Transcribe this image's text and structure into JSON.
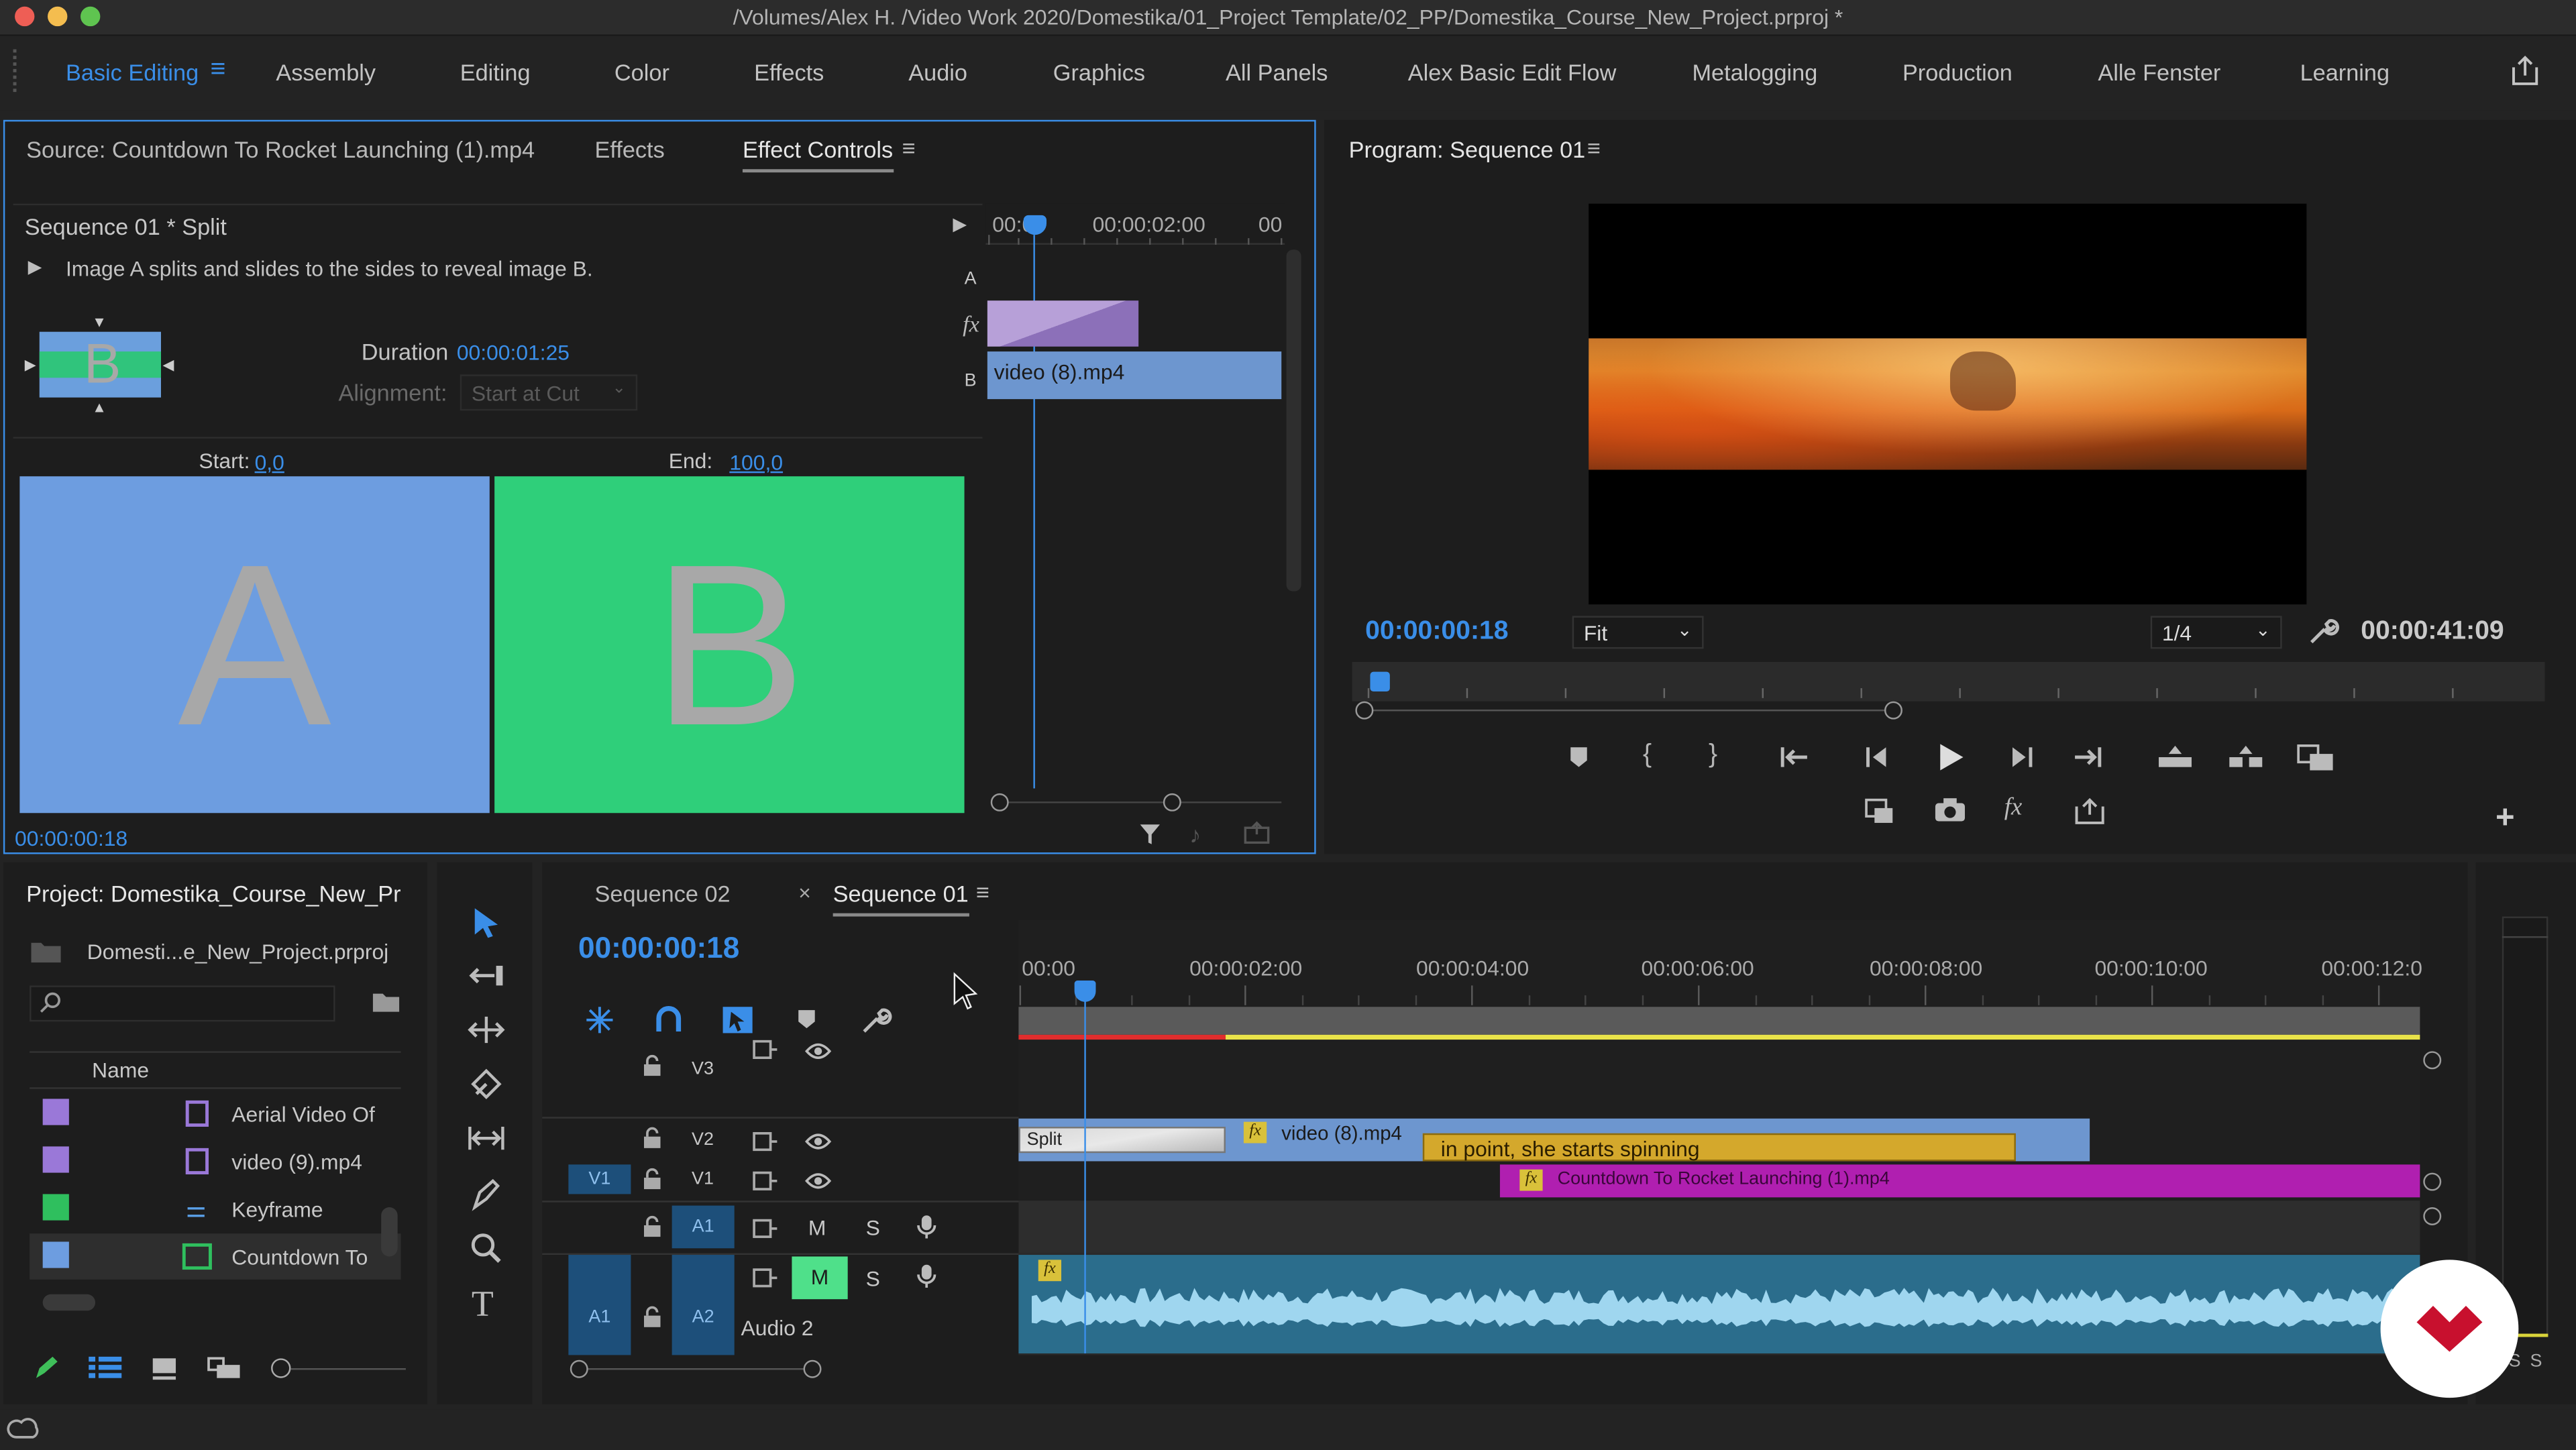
{
  "window": {
    "title": "/Volumes/Alex H. /Video Work 2020/Domestika/01_Project Template/02_PP/Domestika_Course_New_Project.prproj *"
  },
  "workspaces": [
    "Basic Editing",
    "Assembly",
    "Editing",
    "Color",
    "Effects",
    "Audio",
    "Graphics",
    "All Panels",
    "Alex Basic Edit Flow",
    "Metalogging",
    "Production",
    "Alle Fenster",
    "Learning"
  ],
  "source_panel": {
    "tabs": [
      "Source: Countdown To Rocket Launching (1).mp4",
      "Effects",
      "Effect Controls"
    ],
    "sequence_label": "Sequence 01 * Split",
    "description": "Image A splits and slides to the sides to reveal image B.",
    "duration_label": "Duration",
    "duration_value": "00:00:01:25",
    "alignment_label": "Alignment:",
    "alignment_value": "Start at Cut",
    "start_label": "Start:",
    "start_value": "0,0",
    "end_label": "End:",
    "end_value": "100,0",
    "preview_a": "A",
    "preview_b": "B",
    "mini_ruler": [
      "00:00",
      "00:00:02:00",
      "00"
    ],
    "track_a": "A",
    "track_b": "B",
    "fx": "fx",
    "clip_name": "video (8).mp4",
    "timecode": "00:00:00:18"
  },
  "program_panel": {
    "title": "Program: Sequence 01",
    "timecode": "00:00:00:18",
    "fit": "Fit",
    "resolution": "1/4",
    "duration": "00:00:41:09"
  },
  "project_panel": {
    "title": "Project: Domestika_Course_New_Pr",
    "file": "Domesti...e_New_Project.prproj",
    "search_placeholder": "",
    "column": "Name",
    "items": [
      {
        "name": "Aerial Video Of",
        "color": "#9a78d8"
      },
      {
        "name": "video (9).mp4",
        "color": "#9a78d8"
      },
      {
        "name": "Keyframe",
        "color": "#2fbf5e"
      },
      {
        "name": "Countdown To",
        "color": "#6d9de0"
      }
    ]
  },
  "timeline": {
    "tabs": [
      "Sequence 02",
      "Sequence 01"
    ],
    "timecode": "00:00:00:18",
    "ruler": [
      "00:00",
      "00:00:02:00",
      "00:00:04:00",
      "00:00:06:00",
      "00:00:08:00",
      "00:00:10:00",
      "00:00:12:0"
    ],
    "tracks": {
      "v3": "V3",
      "v2": "V2",
      "v1": "V1",
      "a1": "A1",
      "a2": "A2",
      "audio2": "Audio 2",
      "m": "M",
      "s": "S"
    },
    "clips": {
      "split": "Split",
      "video8": "video (8).mp4",
      "marker": "in point, she starts spinning",
      "countdown": "Countdown To Rocket Launching (1).mp4",
      "fx": "fx"
    },
    "meter_s": "S"
  },
  "colors": {
    "accent": "#3a8ee8",
    "clip_blue": "#6d96cf",
    "clip_magenta": "#b01fb0",
    "clip_gold": "#d4a82c",
    "audio": "#5aa7c8"
  }
}
